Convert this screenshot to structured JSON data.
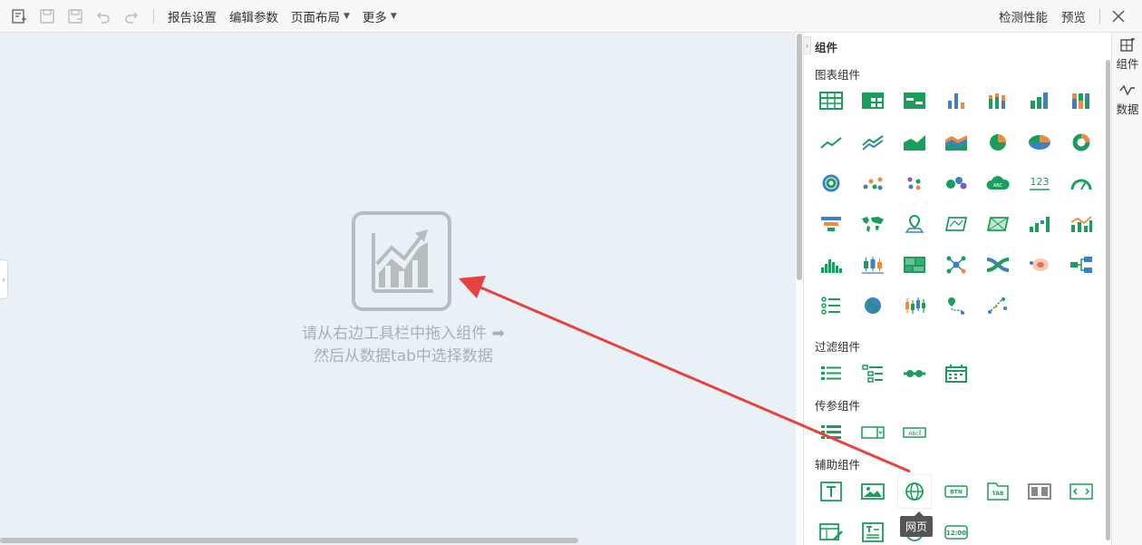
{
  "toolbar": {
    "icons": [
      "new-report-icon",
      "save-icon",
      "save-as-icon",
      "undo-icon",
      "redo-icon"
    ],
    "menus": [
      {
        "label": "报告设置",
        "has_dropdown": false
      },
      {
        "label": "编辑参数",
        "has_dropdown": false
      },
      {
        "label": "页面布局",
        "has_dropdown": true
      },
      {
        "label": "更多",
        "has_dropdown": true
      }
    ],
    "right": {
      "check_label": "检测性能",
      "preview_label": "预览"
    }
  },
  "canvas": {
    "placeholder_line1": "请从右边工具栏中拖入组件",
    "placeholder_line2": "然后从数据tab中选择数据"
  },
  "panel": {
    "title": "组件",
    "sections": {
      "chart": "图表组件",
      "filter": "过滤组件",
      "param": "传参组件",
      "aux": "辅助组件"
    },
    "tooltip": "网页"
  },
  "side_tabs": [
    {
      "label": "组件",
      "icon": "component-icon"
    },
    {
      "label": "数据",
      "icon": "data-icon"
    }
  ],
  "colors": {
    "accent_green": "#1a9e5c",
    "blue": "#3b82c4",
    "orange": "#f08a3c",
    "purple": "#7a5cc4",
    "canvas_bg": "#e9f1f7",
    "arrow_red": "#e8423f"
  }
}
